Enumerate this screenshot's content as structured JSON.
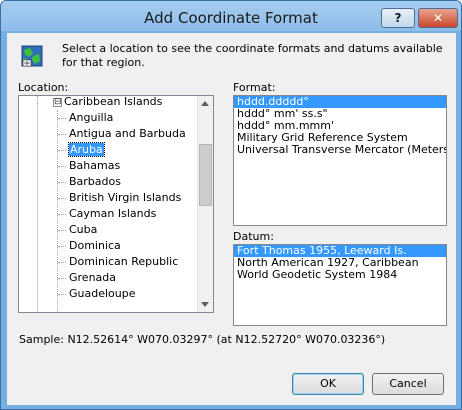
{
  "window": {
    "title": "Add Coordinate Format",
    "help_label": "?",
    "close_label": "✕"
  },
  "intro_text": "Select a location to see the coordinate formats and datums available for that region.",
  "location": {
    "label": "Location:",
    "tree": {
      "parent": {
        "label": "Caribbean Islands",
        "expander": "⊟"
      },
      "items": [
        {
          "label": "Anguilla",
          "selected": false
        },
        {
          "label": "Antigua and Barbuda",
          "selected": false
        },
        {
          "label": "Aruba",
          "selected": true
        },
        {
          "label": "Bahamas",
          "selected": false
        },
        {
          "label": "Barbados",
          "selected": false
        },
        {
          "label": "British Virgin Islands",
          "selected": false
        },
        {
          "label": "Cayman Islands",
          "selected": false
        },
        {
          "label": "Cuba",
          "selected": false
        },
        {
          "label": "Dominica",
          "selected": false
        },
        {
          "label": "Dominican Republic",
          "selected": false
        },
        {
          "label": "Grenada",
          "selected": false
        },
        {
          "label": "Guadeloupe",
          "selected": false
        }
      ]
    }
  },
  "format": {
    "label": "Format:",
    "items": [
      {
        "label": "hddd.ddddd°",
        "selected": true
      },
      {
        "label": "hddd° mm' ss.s\"",
        "selected": false
      },
      {
        "label": "hddd° mm.mmm'",
        "selected": false
      },
      {
        "label": "Military Grid Reference System",
        "selected": false
      },
      {
        "label": "Universal Transverse Mercator (Meters)",
        "selected": false
      }
    ]
  },
  "datum": {
    "label": "Datum:",
    "items": [
      {
        "label": "Fort Thomas 1955, Leeward Is.",
        "selected": true
      },
      {
        "label": "North American 1927, Caribbean",
        "selected": false
      },
      {
        "label": "World Geodetic System 1984",
        "selected": false
      }
    ]
  },
  "sample_text": "Sample: N12.52614°  W070.03297° (at N12.52720°  W070.03236°)",
  "buttons": {
    "ok": "OK",
    "cancel": "Cancel"
  },
  "colors": {
    "selection": "#3399ff",
    "frame": "#75aee0"
  },
  "icons": {
    "app": "globe-map-icon",
    "expander": "tree-collapse-icon"
  }
}
